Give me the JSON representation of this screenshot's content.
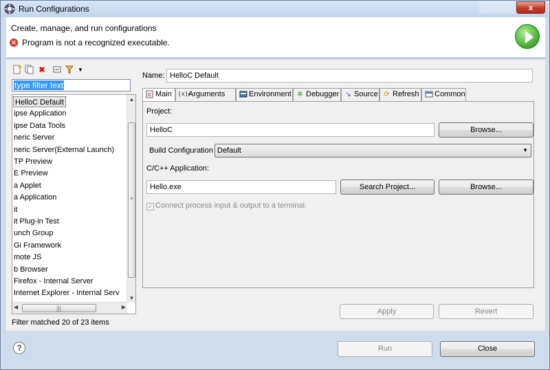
{
  "window": {
    "title": "Run Configurations",
    "close_label": "x"
  },
  "header": {
    "description": "Create, manage, and run configurations",
    "error_icon": "x-circle-icon",
    "error_message": "Program is not a recognized executable."
  },
  "left": {
    "filter_text": "type filter text",
    "tree_items": [
      "HelloC Default",
      "ipse Application",
      "ipse Data Tools",
      "neric Server",
      "neric Server(External Launch)",
      "TP Preview",
      "E Preview",
      "a Applet",
      "a Application",
      "it",
      "it Plug-in Test",
      "unch Group",
      "Gi Framework",
      "mote JS",
      "b Browser",
      "Firefox - Internal Server",
      "Internet Explorer - Internal Serv"
    ],
    "filter_status": "Filter matched 20 of 23 items"
  },
  "right": {
    "name_label": "Name:",
    "name_value": "HelloC Default",
    "tabs": [
      "Main",
      "Arguments",
      "Environment",
      "Debugger",
      "Source",
      "Refresh",
      "Common"
    ],
    "project_label": "Project:",
    "project_value": "HelloC",
    "browse_label": "Browse...",
    "build_config_label": "Build Configuration",
    "build_config_value": "Default",
    "app_label": "C/C++ Application:",
    "app_value": "Hello.exe",
    "search_project_label": "Search Project...",
    "browse2_label": "Browse...",
    "connect_label": "Connect process input & output to a terminal.",
    "apply_label": "Apply",
    "revert_label": "Revert"
  },
  "footer": {
    "help_label": "?",
    "run_label": "Run",
    "close_label": "Close"
  }
}
